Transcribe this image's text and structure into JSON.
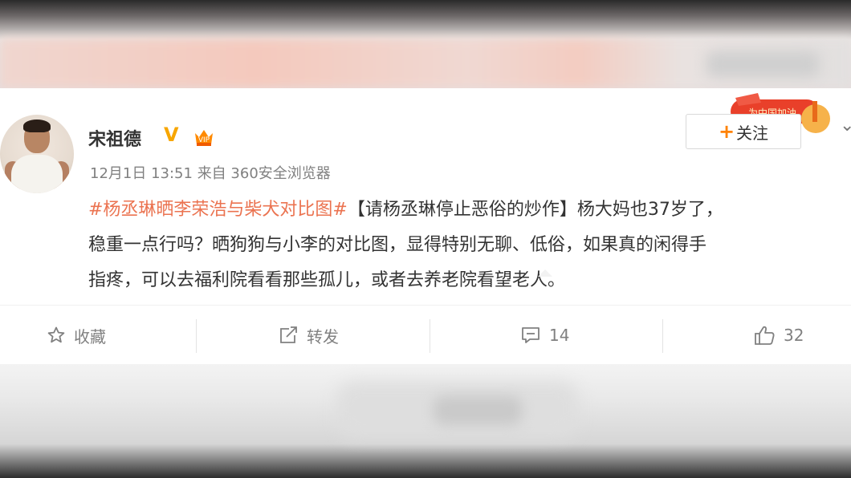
{
  "post": {
    "username": "宋祖德",
    "verified_badge": "V",
    "timestamp": "12月1日 13:51",
    "source": "来自 360安全浏览器",
    "follow_label": "关注",
    "promo_label": "为中国加油",
    "content": {
      "topic": "#杨丞琳晒李荣浩与柴犬对比图#",
      "line1_rest": "【请杨丞琳停止恶俗的炒作】杨大妈也37岁了，",
      "line2": "稳重一点行吗？晒狗狗与小李的对比图，显得特别无聊、低俗，如果真的闲得手",
      "line3": "指疼，可以去福利院看看那些孤儿，或者去养老院看望老人。"
    }
  },
  "actions": {
    "favorite_label": "收藏",
    "repost_label": "转发",
    "comment_count": "14",
    "like_count": "32"
  },
  "icons": {
    "avatar": "avatar",
    "verified": "verified-v-icon",
    "member": "crown-icon",
    "star": "star-icon",
    "share": "share-icon",
    "comment": "comment-icon",
    "like": "thumbs-up-icon",
    "menu": "chevron-down-icon"
  },
  "colors": {
    "topic": "#eb7350",
    "follow_plus": "#ff8200",
    "verified": "#f7a600",
    "text": "#333333",
    "meta": "#808080"
  }
}
